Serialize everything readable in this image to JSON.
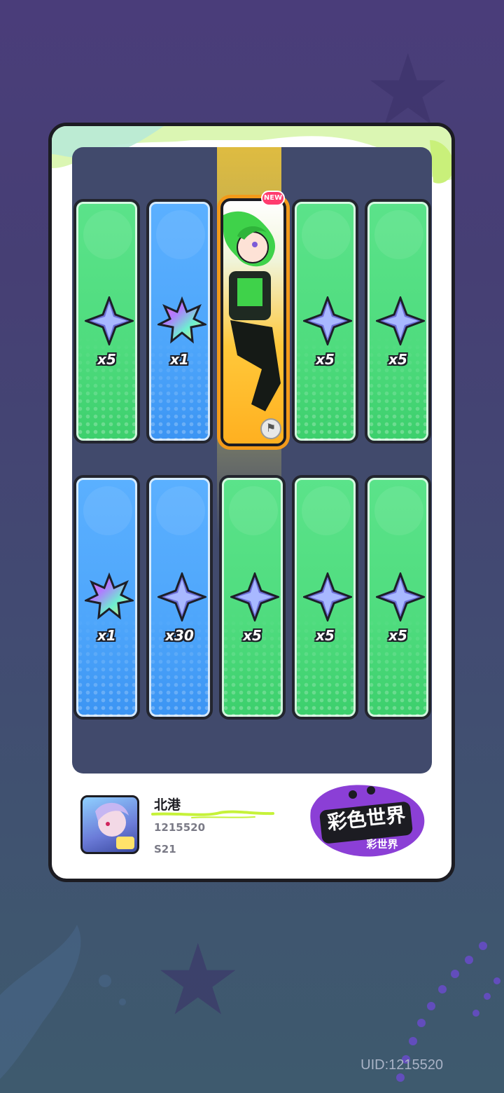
{
  "rewards": {
    "row1": [
      {
        "type": "star",
        "color": "green",
        "qty": "x5"
      },
      {
        "type": "leaf",
        "color": "blue",
        "qty": "x1"
      },
      {
        "type": "character",
        "color": "gold",
        "badge": "NEW"
      },
      {
        "type": "star",
        "color": "green",
        "qty": "x5"
      },
      {
        "type": "star",
        "color": "green",
        "qty": "x5"
      }
    ],
    "row2": [
      {
        "type": "leaf",
        "color": "blue",
        "qty": "x1"
      },
      {
        "type": "star",
        "color": "blue",
        "qty": "x30"
      },
      {
        "type": "star",
        "color": "green",
        "qty": "x5"
      },
      {
        "type": "star",
        "color": "green",
        "qty": "x5"
      },
      {
        "type": "star",
        "color": "green",
        "qty": "x5"
      }
    ]
  },
  "player": {
    "name": "北港",
    "uid": "1215520",
    "season": "S21"
  },
  "logo": {
    "main": "彩色世界",
    "sub": "彩世界"
  },
  "footer_uid": "UID:1215520",
  "colors": {
    "green_card": "#4fdc7e",
    "blue_card": "#4ea6fb",
    "gold_glow": "#f29a1a",
    "accent_lime": "#c6f23a",
    "logo_purple": "#8b3fd6"
  }
}
